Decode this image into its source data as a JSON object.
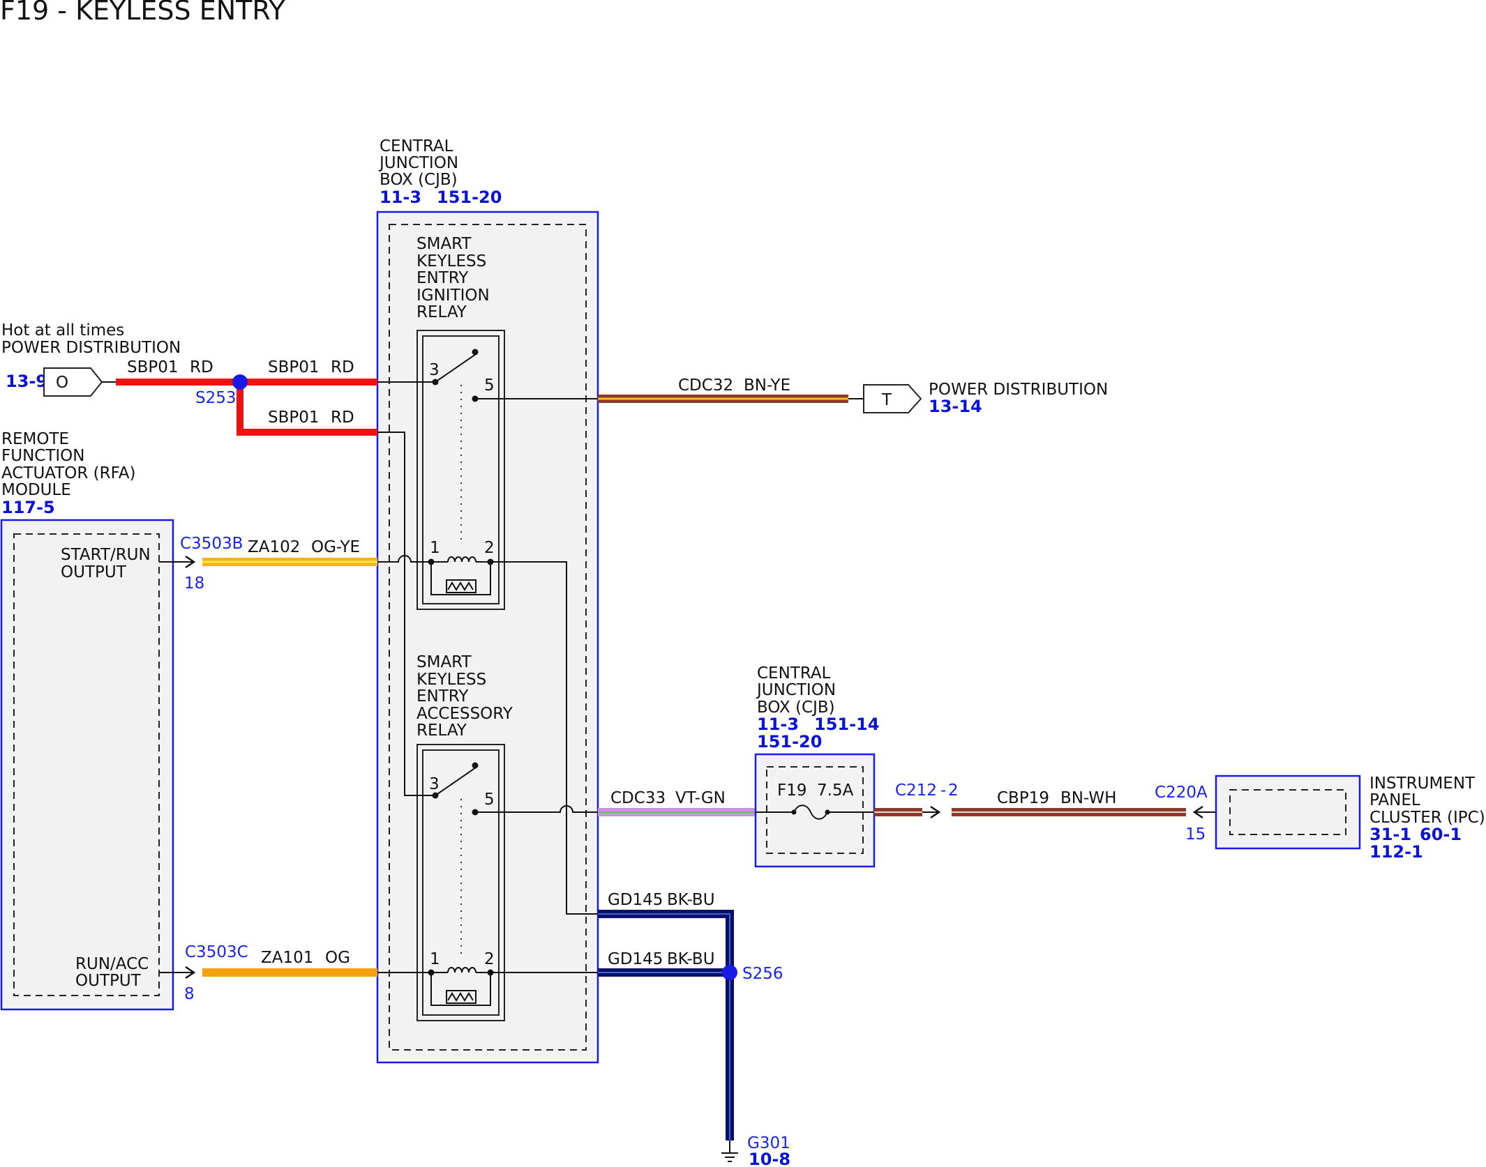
{
  "title": "F19 - KEYLESS ENTRY",
  "colors": {
    "red": "#ee1111",
    "orange": "#f5a10f",
    "orange_yellow": "#f7b21a",
    "brown": "#8a3a2a",
    "violet": "#c896d8",
    "black_blue": "#0b0f6a",
    "box_blue": "#1a1ae6",
    "ref_blue": "#0a12d8",
    "fill_gray": "#f2f2f2"
  },
  "power_source": {
    "label": "Hot at all times",
    "name": "POWER DISTRIBUTION",
    "ref": "13-9",
    "pin": "O"
  },
  "splices": {
    "s253": "S253",
    "s256": "S256"
  },
  "wires": {
    "sbp01_a": {
      "circuit": "SBP01",
      "color": "RD"
    },
    "sbp01_b": {
      "circuit": "SBP01",
      "color": "RD"
    },
    "sbp01_c": {
      "circuit": "SBP01",
      "color": "RD"
    },
    "cdc32": {
      "circuit": "CDC32",
      "color": "BN-YE"
    },
    "za102": {
      "circuit": "ZA102",
      "color": "OG-YE"
    },
    "za101": {
      "circuit": "ZA101",
      "color": "OG"
    },
    "cdc33": {
      "circuit": "CDC33",
      "color": "VT-GN"
    },
    "cbp19": {
      "circuit": "CBP19",
      "color": "BN-WH"
    },
    "gd145_a": {
      "circuit": "GD145",
      "color": "BK-BU"
    },
    "gd145_b": {
      "circuit": "GD145",
      "color": "BK-BU"
    }
  },
  "cjb_main": {
    "name_lines": [
      "CENTRAL",
      "JUNCTION",
      "BOX (CJB)"
    ],
    "refs": [
      "11-3",
      "151-20"
    ]
  },
  "ignition_relay": {
    "name_lines": [
      "SMART",
      "KEYLESS",
      "ENTRY",
      "IGNITION",
      "RELAY"
    ],
    "pins": [
      "3",
      "5",
      "1",
      "2"
    ]
  },
  "accessory_relay": {
    "name_lines": [
      "SMART",
      "KEYLESS",
      "ENTRY",
      "ACCESSORY",
      "RELAY"
    ],
    "pins": [
      "3",
      "5",
      "1",
      "2"
    ]
  },
  "power_dist_out": {
    "pin": "T",
    "name": "POWER DISTRIBUTION",
    "ref": "13-14"
  },
  "rfa_module": {
    "name_lines": [
      "REMOTE",
      "FUNCTION",
      "ACTUATOR (RFA)",
      "MODULE"
    ],
    "ref": "117-5",
    "output1_lines": [
      "START/RUN",
      "OUTPUT"
    ],
    "output2_lines": [
      "RUN/ACC",
      "OUTPUT"
    ],
    "connector1": "C3503B",
    "connector1_pin": "18",
    "connector2": "C3503C",
    "connector2_pin": "8"
  },
  "cjb_fuse": {
    "name_lines": [
      "CENTRAL",
      "JUNCTION",
      "BOX (CJB)"
    ],
    "refs_line1": [
      "11-3",
      "151-14"
    ],
    "refs_line2": "151-20",
    "fuse": "F19",
    "rating": "7.5A",
    "connector": "C212",
    "connector_pin": "2"
  },
  "ipc": {
    "name_lines": [
      "INSTRUMENT",
      "PANEL",
      "CLUSTER (IPC)"
    ],
    "refs_line1": [
      "31-1",
      "60-1"
    ],
    "refs_line2": "112-1",
    "connector": "C220A",
    "connector_pin": "15"
  },
  "ground": {
    "name": "G301",
    "ref": "10-8"
  }
}
